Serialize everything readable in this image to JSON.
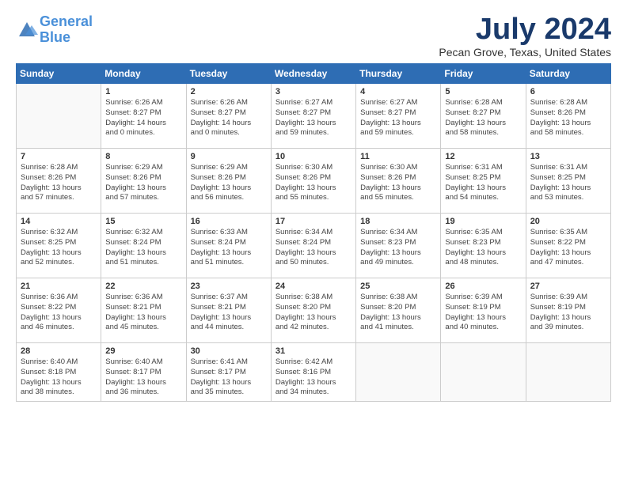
{
  "header": {
    "logo_line1": "General",
    "logo_line2": "Blue",
    "month": "July 2024",
    "location": "Pecan Grove, Texas, United States"
  },
  "days_of_week": [
    "Sunday",
    "Monday",
    "Tuesday",
    "Wednesday",
    "Thursday",
    "Friday",
    "Saturday"
  ],
  "weeks": [
    [
      {
        "day": "",
        "info": ""
      },
      {
        "day": "1",
        "info": "Sunrise: 6:26 AM\nSunset: 8:27 PM\nDaylight: 14 hours\nand 0 minutes."
      },
      {
        "day": "2",
        "info": "Sunrise: 6:26 AM\nSunset: 8:27 PM\nDaylight: 14 hours\nand 0 minutes."
      },
      {
        "day": "3",
        "info": "Sunrise: 6:27 AM\nSunset: 8:27 PM\nDaylight: 13 hours\nand 59 minutes."
      },
      {
        "day": "4",
        "info": "Sunrise: 6:27 AM\nSunset: 8:27 PM\nDaylight: 13 hours\nand 59 minutes."
      },
      {
        "day": "5",
        "info": "Sunrise: 6:28 AM\nSunset: 8:27 PM\nDaylight: 13 hours\nand 58 minutes."
      },
      {
        "day": "6",
        "info": "Sunrise: 6:28 AM\nSunset: 8:26 PM\nDaylight: 13 hours\nand 58 minutes."
      }
    ],
    [
      {
        "day": "7",
        "info": "Sunrise: 6:28 AM\nSunset: 8:26 PM\nDaylight: 13 hours\nand 57 minutes."
      },
      {
        "day": "8",
        "info": "Sunrise: 6:29 AM\nSunset: 8:26 PM\nDaylight: 13 hours\nand 57 minutes."
      },
      {
        "day": "9",
        "info": "Sunrise: 6:29 AM\nSunset: 8:26 PM\nDaylight: 13 hours\nand 56 minutes."
      },
      {
        "day": "10",
        "info": "Sunrise: 6:30 AM\nSunset: 8:26 PM\nDaylight: 13 hours\nand 55 minutes."
      },
      {
        "day": "11",
        "info": "Sunrise: 6:30 AM\nSunset: 8:26 PM\nDaylight: 13 hours\nand 55 minutes."
      },
      {
        "day": "12",
        "info": "Sunrise: 6:31 AM\nSunset: 8:25 PM\nDaylight: 13 hours\nand 54 minutes."
      },
      {
        "day": "13",
        "info": "Sunrise: 6:31 AM\nSunset: 8:25 PM\nDaylight: 13 hours\nand 53 minutes."
      }
    ],
    [
      {
        "day": "14",
        "info": "Sunrise: 6:32 AM\nSunset: 8:25 PM\nDaylight: 13 hours\nand 52 minutes."
      },
      {
        "day": "15",
        "info": "Sunrise: 6:32 AM\nSunset: 8:24 PM\nDaylight: 13 hours\nand 51 minutes."
      },
      {
        "day": "16",
        "info": "Sunrise: 6:33 AM\nSunset: 8:24 PM\nDaylight: 13 hours\nand 51 minutes."
      },
      {
        "day": "17",
        "info": "Sunrise: 6:34 AM\nSunset: 8:24 PM\nDaylight: 13 hours\nand 50 minutes."
      },
      {
        "day": "18",
        "info": "Sunrise: 6:34 AM\nSunset: 8:23 PM\nDaylight: 13 hours\nand 49 minutes."
      },
      {
        "day": "19",
        "info": "Sunrise: 6:35 AM\nSunset: 8:23 PM\nDaylight: 13 hours\nand 48 minutes."
      },
      {
        "day": "20",
        "info": "Sunrise: 6:35 AM\nSunset: 8:22 PM\nDaylight: 13 hours\nand 47 minutes."
      }
    ],
    [
      {
        "day": "21",
        "info": "Sunrise: 6:36 AM\nSunset: 8:22 PM\nDaylight: 13 hours\nand 46 minutes."
      },
      {
        "day": "22",
        "info": "Sunrise: 6:36 AM\nSunset: 8:21 PM\nDaylight: 13 hours\nand 45 minutes."
      },
      {
        "day": "23",
        "info": "Sunrise: 6:37 AM\nSunset: 8:21 PM\nDaylight: 13 hours\nand 44 minutes."
      },
      {
        "day": "24",
        "info": "Sunrise: 6:38 AM\nSunset: 8:20 PM\nDaylight: 13 hours\nand 42 minutes."
      },
      {
        "day": "25",
        "info": "Sunrise: 6:38 AM\nSunset: 8:20 PM\nDaylight: 13 hours\nand 41 minutes."
      },
      {
        "day": "26",
        "info": "Sunrise: 6:39 AM\nSunset: 8:19 PM\nDaylight: 13 hours\nand 40 minutes."
      },
      {
        "day": "27",
        "info": "Sunrise: 6:39 AM\nSunset: 8:19 PM\nDaylight: 13 hours\nand 39 minutes."
      }
    ],
    [
      {
        "day": "28",
        "info": "Sunrise: 6:40 AM\nSunset: 8:18 PM\nDaylight: 13 hours\nand 38 minutes."
      },
      {
        "day": "29",
        "info": "Sunrise: 6:40 AM\nSunset: 8:17 PM\nDaylight: 13 hours\nand 36 minutes."
      },
      {
        "day": "30",
        "info": "Sunrise: 6:41 AM\nSunset: 8:17 PM\nDaylight: 13 hours\nand 35 minutes."
      },
      {
        "day": "31",
        "info": "Sunrise: 6:42 AM\nSunset: 8:16 PM\nDaylight: 13 hours\nand 34 minutes."
      },
      {
        "day": "",
        "info": ""
      },
      {
        "day": "",
        "info": ""
      },
      {
        "day": "",
        "info": ""
      }
    ]
  ]
}
